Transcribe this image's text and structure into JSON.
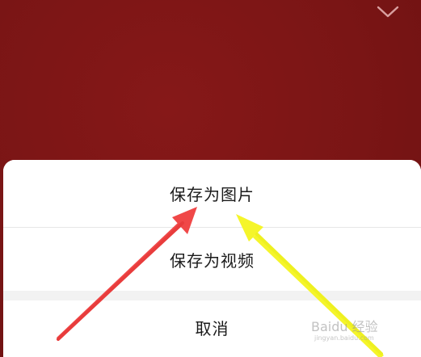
{
  "sheet": {
    "options": [
      {
        "label": "保存为图片"
      },
      {
        "label": "保存为视频"
      }
    ],
    "cancel_label": "取消"
  },
  "header": {
    "collapse_icon": "chevron-down-icon"
  },
  "annotations": {
    "left_arrow_color": "#f04848",
    "right_arrow_color": "#f5f52a"
  },
  "watermark": {
    "text": "Baidu 经验",
    "subtext": "jingyan.baidu.com"
  },
  "colors": {
    "backdrop": "#7a1414",
    "sheet": "#ffffff",
    "divider": "#e6e6e6",
    "gap": "#f2f2f2",
    "text": "#1a1a1a"
  }
}
